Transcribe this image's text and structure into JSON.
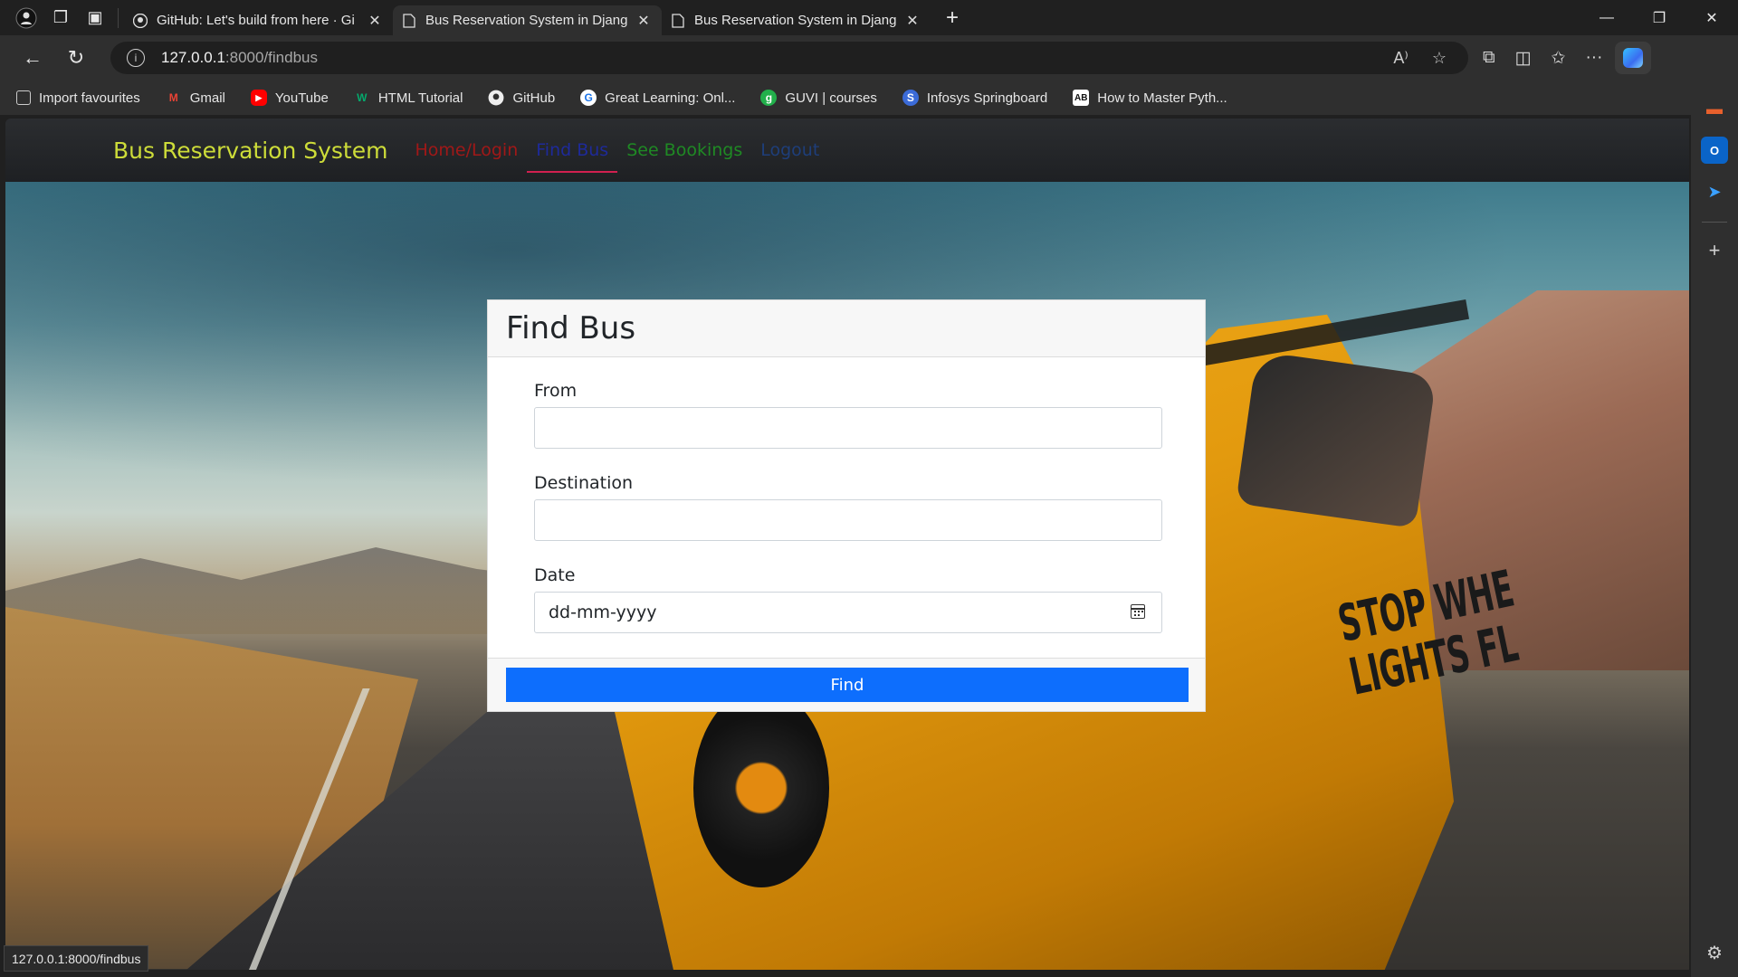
{
  "tabs": [
    {
      "title": "GitHub: Let's build from here · Gi",
      "active": false
    },
    {
      "title": "Bus Reservation System in Djang",
      "active": true
    },
    {
      "title": "Bus Reservation System in Djang",
      "active": false
    }
  ],
  "address": {
    "host": "127.0.0.1",
    "path": ":8000/findbus"
  },
  "bookmarks": [
    {
      "label": "Import favourites",
      "icon": "import-icon"
    },
    {
      "label": "Gmail",
      "icon": "gmail-icon"
    },
    {
      "label": "YouTube",
      "icon": "youtube-icon"
    },
    {
      "label": "HTML Tutorial",
      "icon": "w3schools-icon"
    },
    {
      "label": "GitHub",
      "icon": "github-icon"
    },
    {
      "label": "Great Learning: Onl...",
      "icon": "greatlearning-icon"
    },
    {
      "label": "GUVI | courses",
      "icon": "guvi-icon"
    },
    {
      "label": "Infosys Springboard",
      "icon": "infosys-icon"
    },
    {
      "label": "How to Master Pyth...",
      "icon": "ab-icon"
    }
  ],
  "navbar": {
    "brand": "Bus Reservation System",
    "links": [
      "Home/Login",
      "Find Bus",
      "See Bookings",
      "Logout"
    ],
    "active": "Find Bus"
  },
  "form": {
    "title": "Find Bus",
    "from_label": "From",
    "destination_label": "Destination",
    "date_label": "Date",
    "date_placeholder": "dd-mm-yyyy",
    "from_value": "",
    "destination_value": "",
    "submit_label": "Find"
  },
  "background": {
    "bus_text": "STOP WHE\nLIGHTS FL"
  },
  "status_url": "127.0.0.1:8000/findbus",
  "colors": {
    "brand": "#cddc39",
    "primary_button": "#0d6efd",
    "home_link": "#a01818",
    "find_link": "#1e2a9a",
    "bookings_link": "#1f8a24",
    "logout_link": "#1e3e7a"
  }
}
